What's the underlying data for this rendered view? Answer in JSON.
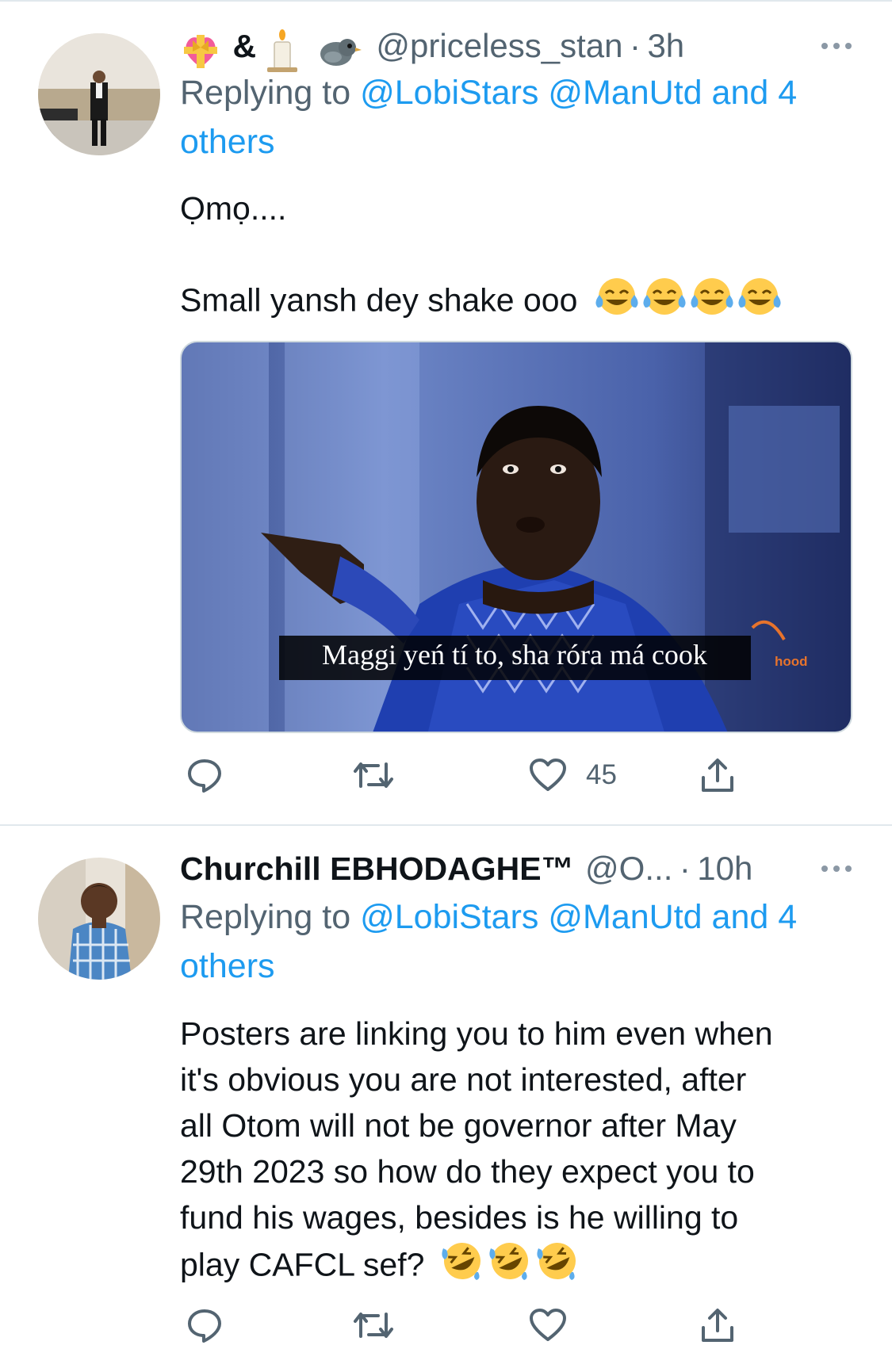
{
  "colors": {
    "accent": "#1d9bf0",
    "secondary_text": "#536471",
    "primary_text": "#0f1419",
    "divider": "#e1e8ed"
  },
  "tweets": [
    {
      "author_emojis": [
        "heart-with-ribbon-emoji",
        "candle-emoji",
        "bird-emoji"
      ],
      "name_ampersand": "&",
      "handle": "@priceless_stan",
      "separator": "·",
      "time": "3h",
      "replying_prefix": "Replying to",
      "mention_1": "@LobiStars",
      "mention_2": "@ManUtd",
      "and_others": "and 4 others",
      "text_line_1": "Ọmọ....",
      "text_line_2": "Small yansh dey shake ooo",
      "text_emojis": [
        "tears-of-joy-emoji",
        "tears-of-joy-emoji",
        "tears-of-joy-emoji",
        "tears-of-joy-emoji"
      ],
      "media_caption": "Maggi yeń tí to, sha róra má cook",
      "media_watermark": "hood",
      "like_count": "45"
    },
    {
      "name": "Churchill EBHODAGHE™",
      "handle": "@O...",
      "separator": "·",
      "time": "10h",
      "replying_prefix": "Replying to",
      "mention_1": "@LobiStars",
      "mention_2": "@ManUtd",
      "and_others": "and 4 others",
      "text_lines": [
        "Posters are linking you to him even when",
        "it's obvious you are not interested, after",
        "all Otom will not be governor after May",
        "29th 2023 so how do they expect you to",
        "fund his wages, besides is he willing to",
        "play CAFCL sef?"
      ],
      "text_emojis": [
        "rolling-laughing-emoji",
        "rolling-laughing-emoji",
        "rolling-laughing-emoji"
      ]
    }
  ]
}
